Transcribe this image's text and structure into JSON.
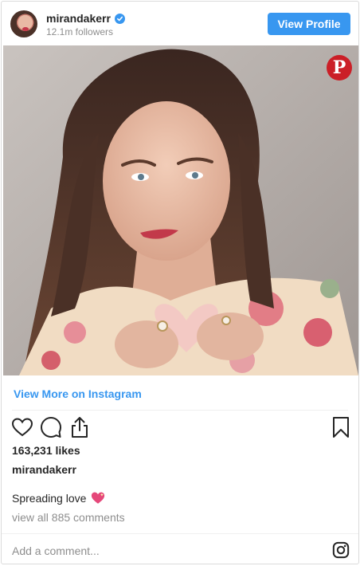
{
  "header": {
    "username": "mirandakerr",
    "followers": "12.1m followers",
    "view_profile_label": "View Profile",
    "verified_icon": "verified-badge-icon"
  },
  "photo": {
    "pin_button_glyph": "P",
    "pin_icon": "pinterest-icon"
  },
  "links": {
    "view_more": "View More on Instagram"
  },
  "actions": {
    "icons": [
      "heart-icon",
      "comment-icon",
      "share-icon",
      "bookmark-icon"
    ]
  },
  "post": {
    "likes": "163,231 likes",
    "caption_user": "mirandakerr",
    "caption_text": "Spreading love",
    "caption_emoji": "sparkling-heart-icon",
    "comments_link": "view all 885 comments",
    "comment_placeholder": "Add a comment..."
  },
  "colors": {
    "accent": "#3897f0",
    "pinterest": "#cb1f27",
    "muted_text": "#8e8e8e",
    "text": "#262626"
  }
}
